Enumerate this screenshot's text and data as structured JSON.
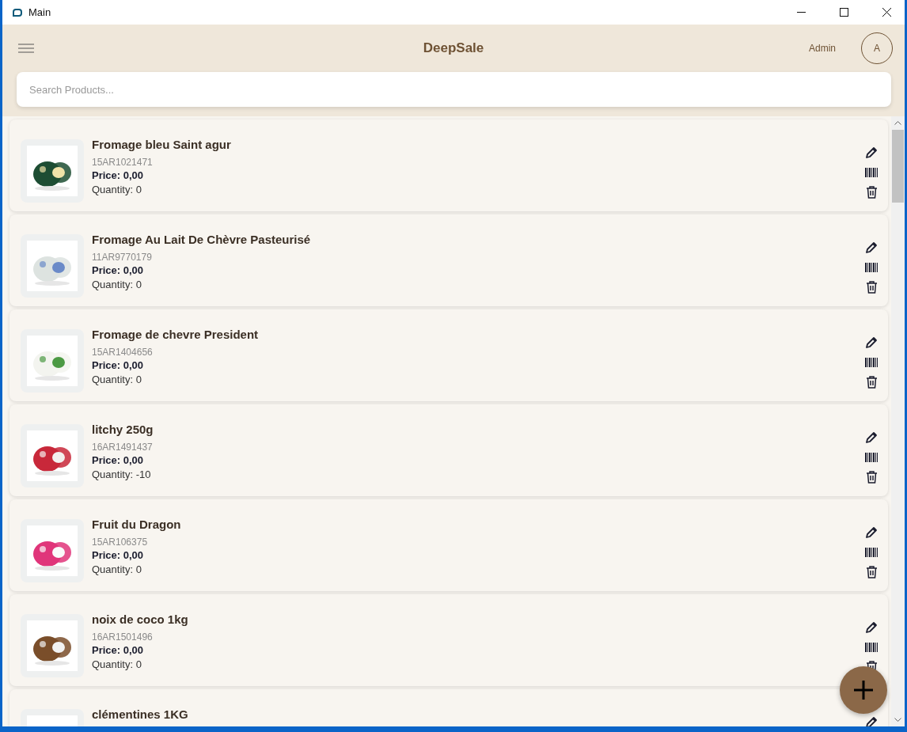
{
  "window": {
    "title": "Main"
  },
  "header": {
    "title": "DeepSale",
    "user": "Admin",
    "avatar": "A"
  },
  "search": {
    "placeholder": "Search Products..."
  },
  "products": [
    {
      "name": "Fromage bleu Saint agur",
      "code": "15AR1021471",
      "price": "Price: 0,00",
      "quantity": "Quantity: 0"
    },
    {
      "name": "Fromage Au Lait De Chèvre Pasteurisé",
      "code": "11AR9770179",
      "price": "Price: 0,00",
      "quantity": "Quantity: 0"
    },
    {
      "name": "Fromage de chevre President",
      "code": "15AR1404656",
      "price": "Price: 0,00",
      "quantity": "Quantity: 0"
    },
    {
      "name": "litchy 250g",
      "code": "16AR1491437",
      "price": "Price: 0,00",
      "quantity": "Quantity: -10"
    },
    {
      "name": "Fruit du Dragon",
      "code": "15AR106375",
      "price": "Price: 0,00",
      "quantity": "Quantity: 0"
    },
    {
      "name": "noix de coco 1kg",
      "code": "16AR1501496",
      "price": "Price: 0,00",
      "quantity": "Quantity: 0"
    },
    {
      "name": "clémentines 1KG"
    }
  ]
}
